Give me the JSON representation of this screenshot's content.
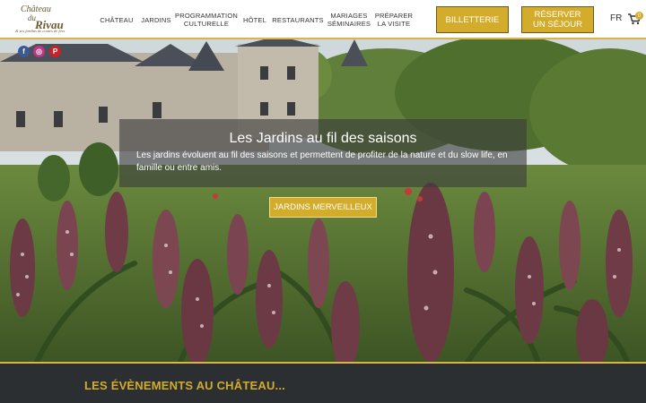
{
  "logo": {
    "line1": "Château",
    "line2": "du",
    "line3": "Rivau",
    "tagline": "& ses jardins de contes de fées"
  },
  "nav": {
    "items": [
      {
        "label": "CHÂTEAU"
      },
      {
        "label": "JARDINS"
      },
      {
        "label": "PROGRAMMATION CULTURELLE"
      },
      {
        "label": "HÔTEL"
      },
      {
        "label": "RESTAURANTS"
      },
      {
        "label": "MARIAGES SÉMINAIRES"
      },
      {
        "label": "PRÉPARER LA VISITE"
      }
    ],
    "billetterie_label": "BILLETTERIE",
    "reserver_label": "RÉSERVER UN SÉJOUR",
    "lang": "FR",
    "cart_count": "0"
  },
  "social": [
    {
      "icon": "facebook-icon",
      "glyph": "f",
      "color": "#3b5998"
    },
    {
      "icon": "instagram-icon",
      "glyph": "◎",
      "color": "#c13584"
    },
    {
      "icon": "pinterest-icon",
      "glyph": "P",
      "color": "#cb2027"
    }
  ],
  "hero": {
    "title": "Les Jardins au fil des saisons",
    "text": "Les jardins évoluent au fil des saisons et permettent de profiter de la nature et du slow life, en famille ou entre amis.",
    "button_label": "JARDINS MERVEILLEUX"
  },
  "events": {
    "title": "LES ÉVÈNEMENTS AU CHÂTEAU..."
  },
  "colors": {
    "accent": "#d4ac2b",
    "band": "#2b2f32"
  }
}
